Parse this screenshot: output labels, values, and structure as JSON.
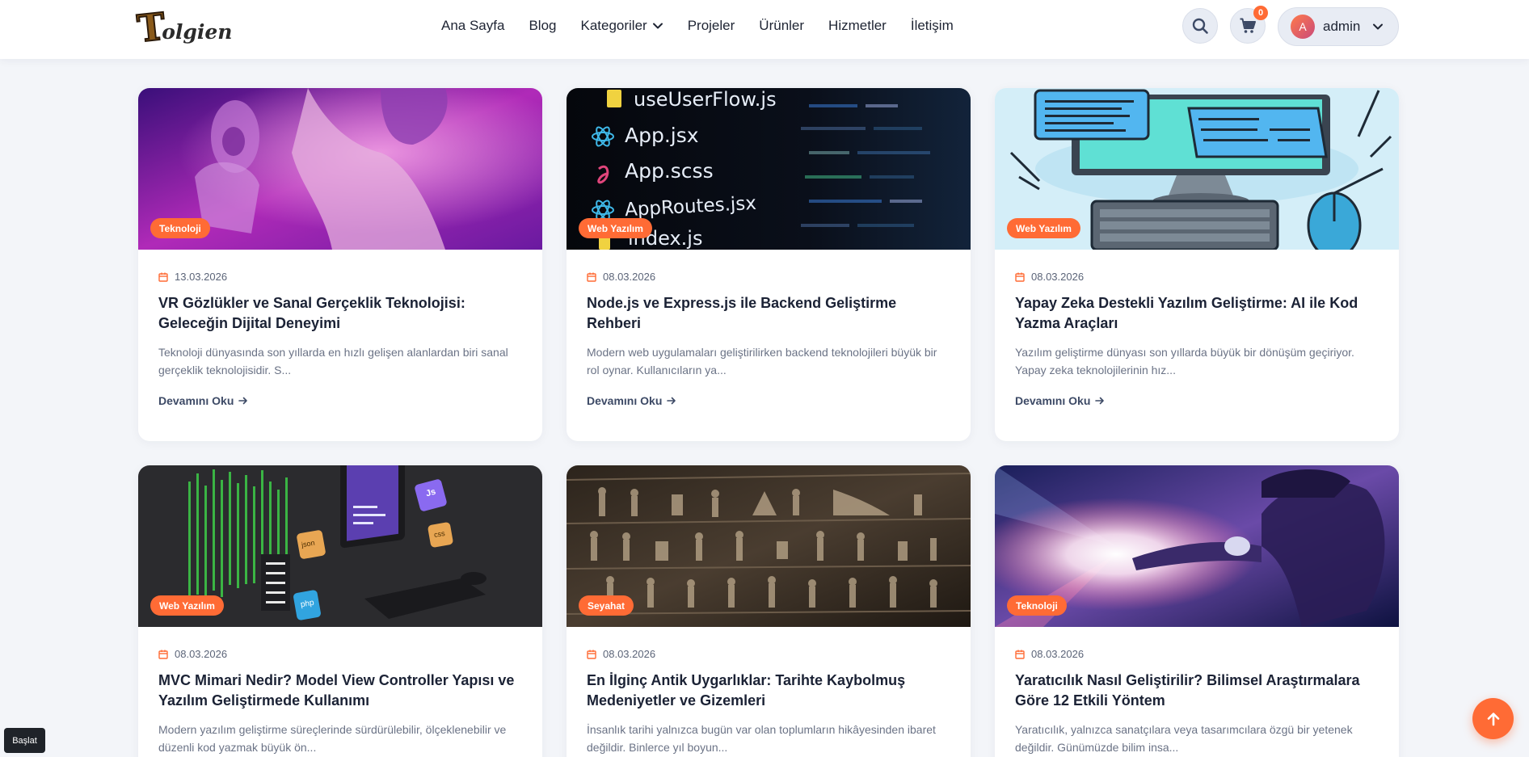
{
  "header": {
    "logo_initial": "T",
    "logo_rest": "olgien",
    "nav": [
      {
        "label": "Ana Sayfa"
      },
      {
        "label": "Blog"
      },
      {
        "label": "Kategoriler"
      },
      {
        "label": "Projeler"
      },
      {
        "label": "Ürünler"
      },
      {
        "label": "Hizmetler"
      },
      {
        "label": "İletişim"
      }
    ],
    "search_icon": "search-icon",
    "cart_icon": "cart-icon",
    "cart_count": "0",
    "user": {
      "initial": "A",
      "name": "admin"
    }
  },
  "posts": [
    {
      "category": "Teknoloji",
      "date": "13.03.2026",
      "title": "VR Gözlükler ve Sanal Gerçeklik Teknolojisi: Geleceğin Dijital Deneyimi",
      "excerpt": "Teknoloji dünyasında son yıllarda en hızlı gelişen alanlardan biri sanal gerçeklik teknolojisidir. S...",
      "read_more": "Devamını Oku"
    },
    {
      "category": "Web Yazılım",
      "date": "08.03.2026",
      "title": "Node.js ve Express.js ile Backend Geliştirme Rehberi",
      "excerpt": "Modern web uygulamaları geliştirilirken backend teknolojileri büyük bir rol oynar. Kullanıcıların ya...",
      "read_more": "Devamını Oku",
      "image_text": [
        "useUserFlow.js",
        "App.jsx",
        "App.scss",
        "AppRoutes.jsx",
        "index.js"
      ]
    },
    {
      "category": "Web Yazılım",
      "date": "08.03.2026",
      "title": "Yapay Zeka Destekli Yazılım Geliştirme: AI ile Kod Yazma Araçları",
      "excerpt": "Yazılım geliştirme dünyası son yıllarda büyük bir dönüşüm geçiriyor. Yapay zeka teknolojilerinin hız...",
      "read_more": "Devamını Oku"
    },
    {
      "category": "Web Yazılım",
      "date": "08.03.2026",
      "title": "MVC Mimari Nedir? Model View Controller Yapısı ve Yazılım Geliştirmede Kullanımı",
      "excerpt": "Modern yazılım geliştirme süreçlerinde sürdürülebilir, ölçeklenebilir ve düzenli kod yazmak büyük ön...",
      "read_more": "Devamını Oku",
      "image_text": [
        "Js",
        "css",
        "php",
        "json"
      ]
    },
    {
      "category": "Seyahat",
      "date": "08.03.2026",
      "title": "En İlginç Antik Uygarlıklar: Tarihte Kaybolmuş Medeniyetler ve Gizemleri",
      "excerpt": "İnsanlık tarihi yalnızca bugün var olan toplumların hikâyesinden ibaret değildir. Binlerce yıl boyun...",
      "read_more": "Devamını Oku"
    },
    {
      "category": "Teknoloji",
      "date": "08.03.2026",
      "title": "Yaratıcılık Nasıl Geliştirilir? Bilimsel Araştırmalara Göre 12 Etkili Yöntem",
      "excerpt": "Yaratıcılık, yalnızca sanatçılara veya tasarımcılara özgü bir yetenek değildir. Günümüzde bilim insa...",
      "read_more": "Devamını Oku"
    }
  ],
  "start_button": "Başlat",
  "scroll_top_icon": "arrow-up-icon",
  "colors": {
    "accent": "#ff6b35",
    "background": "#f3f5f9",
    "heading": "#1b2235"
  }
}
